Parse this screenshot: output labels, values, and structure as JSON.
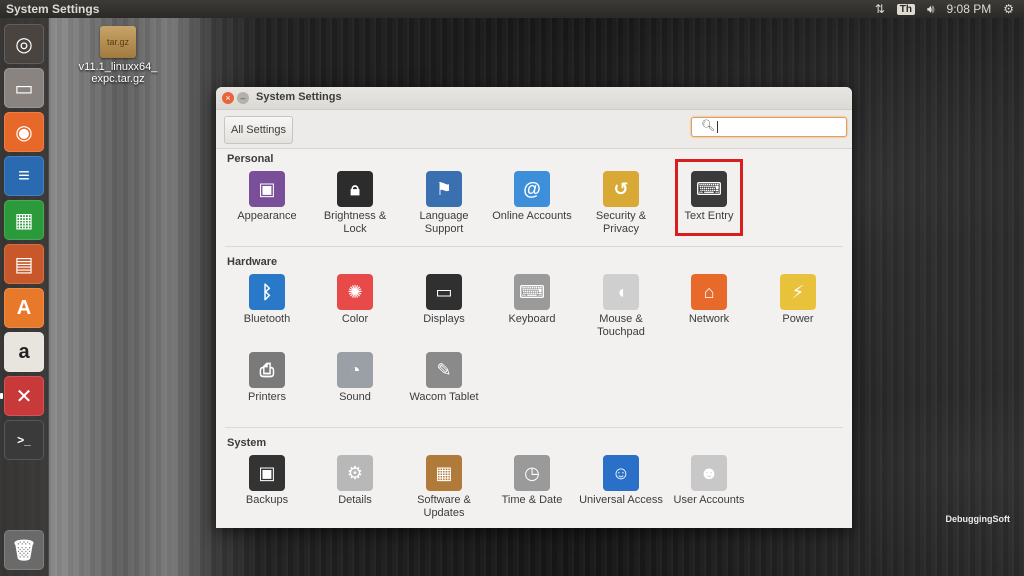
{
  "top_panel": {
    "title": "System Settings",
    "keyboard_indicator": "Th",
    "time": "9:08 PM"
  },
  "desktop": {
    "file": {
      "icon_text": "tar.gz",
      "name": "v11.1_linuxx64_\nexpc.tar.gz"
    }
  },
  "watermark": "DebuggingSoft",
  "window": {
    "title": "System Settings",
    "all_settings_label": "All Settings",
    "search_value": "",
    "sections": [
      {
        "title": "Personal",
        "items": [
          {
            "label": "Appearance",
            "icon": "appearance-icon",
            "color": "#7a4f9a"
          },
          {
            "label": "Brightness & Lock",
            "icon": "brightness-lock-icon",
            "color": "#2c2c2c"
          },
          {
            "label": "Language Support",
            "icon": "language-support-icon",
            "color": "#3a6fb0"
          },
          {
            "label": "Online Accounts",
            "icon": "online-accounts-icon",
            "color": "#3c8fd8"
          },
          {
            "label": "Security & Privacy",
            "icon": "security-privacy-icon",
            "color": "#d9a935"
          },
          {
            "label": "Text Entry",
            "icon": "text-entry-icon",
            "color": "#3a3a3a"
          }
        ]
      },
      {
        "title": "Hardware",
        "items": [
          {
            "label": "Bluetooth",
            "icon": "bluetooth-icon",
            "color": "#2a78c8"
          },
          {
            "label": "Color",
            "icon": "color-icon",
            "color": "#e84a4a"
          },
          {
            "label": "Displays",
            "icon": "displays-icon",
            "color": "#303030"
          },
          {
            "label": "Keyboard",
            "icon": "keyboard-icon",
            "color": "#9a9a9a"
          },
          {
            "label": "Mouse & Touchpad",
            "icon": "mouse-icon",
            "color": "#cfcfcf"
          },
          {
            "label": "Network",
            "icon": "network-icon",
            "color": "#e86a2a"
          },
          {
            "label": "Power",
            "icon": "power-icon",
            "color": "#e8c23a"
          },
          {
            "label": "Printers",
            "icon": "printer-icon",
            "color": "#7a7a7a"
          },
          {
            "label": "Sound",
            "icon": "sound-icon",
            "color": "#9aa0a6"
          },
          {
            "label": "Wacom Tablet",
            "icon": "wacom-tablet-icon",
            "color": "#8a8a8a"
          }
        ]
      },
      {
        "title": "System",
        "items": [
          {
            "label": "Backups",
            "icon": "backups-icon",
            "color": "#333333"
          },
          {
            "label": "Details",
            "icon": "details-icon",
            "color": "#b8b8b8"
          },
          {
            "label": "Software & Updates",
            "icon": "software-updates-icon",
            "color": "#b07a3a"
          },
          {
            "label": "Time & Date",
            "icon": "clock-icon",
            "color": "#9a9a9a"
          },
          {
            "label": "Universal Access",
            "icon": "universal-access-icon",
            "color": "#2a6fc8"
          },
          {
            "label": "User Accounts",
            "icon": "user-accounts-icon",
            "color": "#c8c8c8"
          }
        ]
      }
    ]
  },
  "launcher_items": [
    {
      "name": "ubuntu-dash-icon",
      "color": "#4a4440"
    },
    {
      "name": "files-icon",
      "color": "#8a8480"
    },
    {
      "name": "firefox-icon",
      "color": "#e8682a"
    },
    {
      "name": "libreoffice-writer-icon",
      "color": "#2a6ab0"
    },
    {
      "name": "libreoffice-calc-icon",
      "color": "#2a9a3a"
    },
    {
      "name": "libreoffice-impress-icon",
      "color": "#c8582a"
    },
    {
      "name": "software-center-icon",
      "color": "#e8782a"
    },
    {
      "name": "amazon-icon",
      "color": "#e8e4de"
    },
    {
      "name": "system-settings-icon",
      "color": "#c83a3a"
    },
    {
      "name": "terminal-icon",
      "color": "#3a3a3a"
    },
    {
      "name": "trash-icon",
      "color": "#6a6a6a"
    }
  ]
}
